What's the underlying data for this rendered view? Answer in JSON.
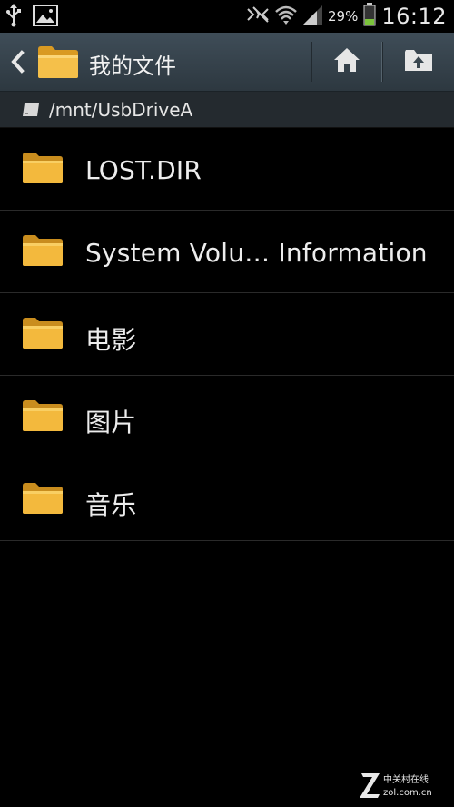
{
  "status_bar": {
    "battery_percent": "29%",
    "time": "16:12",
    "icons": [
      "usb-icon",
      "image-notification-icon",
      "nfc-icon",
      "wifi-icon",
      "signal-icon",
      "battery-icon"
    ]
  },
  "action_bar": {
    "title": "我的文件",
    "icons": [
      "back-chevron-icon",
      "folder-icon",
      "home-icon",
      "up-folder-icon"
    ]
  },
  "path_bar": {
    "path": "/mnt/UsbDriveA"
  },
  "files": [
    {
      "name": "LOST.DIR",
      "type": "folder"
    },
    {
      "name": "System Volu… Information",
      "type": "folder"
    },
    {
      "name": "电影",
      "type": "folder"
    },
    {
      "name": "图片",
      "type": "folder"
    },
    {
      "name": "音乐",
      "type": "folder"
    }
  ],
  "watermark": {
    "line1": "中关村在线",
    "line2": "zol.com.cn"
  },
  "colors": {
    "action_bar": "#3a4750",
    "folder": "#f2b73c",
    "battery_fill": "#7bc43b"
  }
}
